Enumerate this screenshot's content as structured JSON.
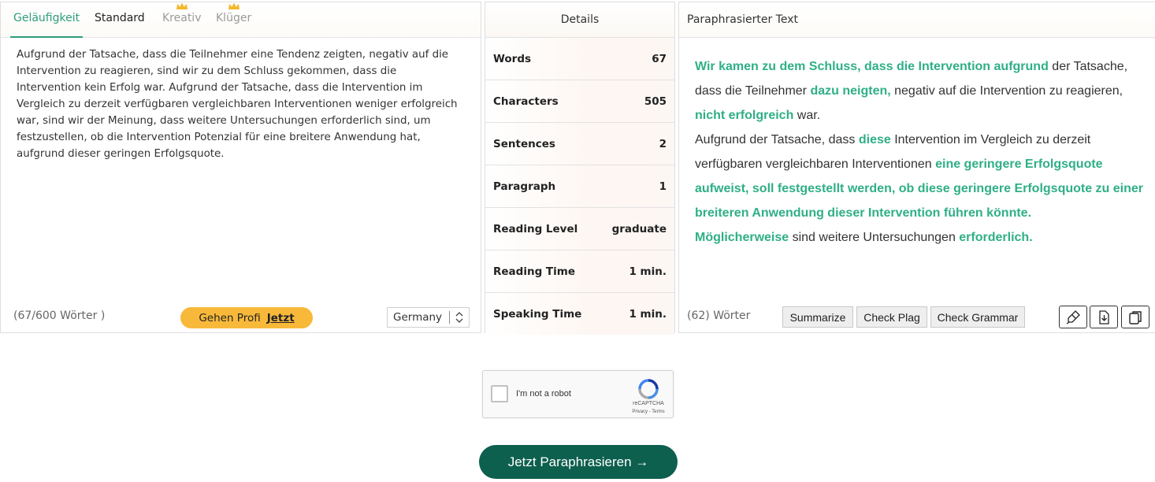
{
  "tabs": [
    {
      "label": "Geläufigkeit",
      "state": "active"
    },
    {
      "label": "Standard",
      "state": "normal"
    },
    {
      "label": "Kreativ",
      "state": "premium"
    },
    {
      "label": "Klüger",
      "state": "premium"
    }
  ],
  "input": {
    "text": "Aufgrund der Tatsache, dass die Teilnehmer eine Tendenz zeigten, negativ auf die Intervention zu reagieren, sind wir zu dem Schluss gekommen, dass die Intervention kein Erfolg war. Aufgrund der Tatsache, dass die Intervention im Vergleich zu derzeit verfügbaren vergleichbaren Interventionen weniger erfolgreich war, sind wir der Meinung, dass weitere Untersuchungen erforderlich sind, um festzustellen, ob die Intervention Potenzial für eine breitere Anwendung hat, aufgrund dieser geringen Erfolgsquote.",
    "word_count": "(67/600 Wörter )",
    "pro_label": "Gehen Profi",
    "pro_now": "Jetzt",
    "language": "Germany"
  },
  "details": {
    "title": "Details",
    "rows": [
      {
        "label": "Words",
        "value": "67"
      },
      {
        "label": "Characters",
        "value": "505"
      },
      {
        "label": "Sentences",
        "value": "2"
      },
      {
        "label": "Paragraph",
        "value": "1"
      },
      {
        "label": "Reading Level",
        "value": "graduate"
      },
      {
        "label": "Reading Time",
        "value": "1 min."
      },
      {
        "label": "Speaking Time",
        "value": "1 min."
      }
    ]
  },
  "output": {
    "title": "Paraphrasierter Text",
    "segments": [
      {
        "t": "Wir kamen zu dem Schluss, dass die Intervention aufgrund",
        "hl": true
      },
      {
        "t": " der Tatsache, dass die Teilnehmer ",
        "hl": false
      },
      {
        "t": "dazu neigten,",
        "hl": true
      },
      {
        "t": " negativ auf die Intervention zu reagieren, ",
        "hl": false
      },
      {
        "t": "nicht erfolgreich",
        "hl": true
      },
      {
        "t": " war.",
        "hl": false
      },
      {
        "br": true
      },
      {
        "t": " Aufgrund der Tatsache, dass ",
        "hl": false
      },
      {
        "t": "diese",
        "hl": true
      },
      {
        "t": " Intervention im Vergleich zu derzeit verfügbaren vergleichbaren Interventionen ",
        "hl": false
      },
      {
        "t": "eine geringere Erfolgsquote aufweist, soll festgestellt werden, ob diese geringere Erfolgsquote zu einer breiteren Anwendung dieser Intervention führen könnte.",
        "hl": true
      },
      {
        "br": true
      },
      {
        "t": " Möglicherweise",
        "hl": true
      },
      {
        "t": " sind  weitere Untersuchungen ",
        "hl": false
      },
      {
        "t": "erforderlich.",
        "hl": true
      }
    ],
    "word_count": "(62) Wörter",
    "buttons": {
      "summarize": "Summarize",
      "check_plag": "Check Plag",
      "check_grammar": "Check Grammar"
    }
  },
  "captcha": {
    "label": "I'm not a robot",
    "brand": "reCAPTCHA",
    "terms": "Privacy - Terms"
  },
  "submit_label": "Jetzt Paraphrasieren →",
  "colors": {
    "accent": "#2faf86",
    "primary": "#0d5f4e",
    "pro": "#f8b93a",
    "crown": "#f5b82e"
  },
  "icons": {
    "highlighter": "highlighter-icon",
    "download": "download-icon",
    "copy": "copy-icon",
    "crown": "crown-icon"
  }
}
